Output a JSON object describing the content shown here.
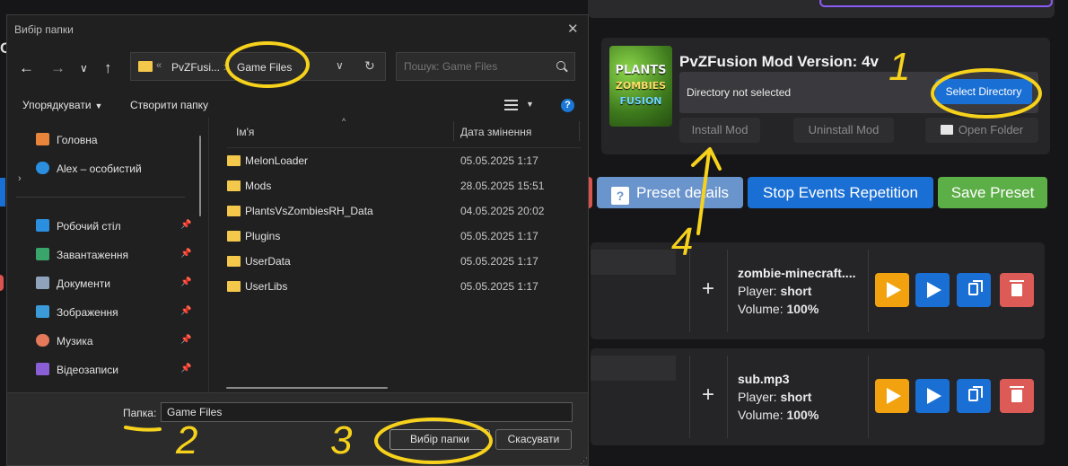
{
  "dialog": {
    "title": "Вибір папки",
    "address": {
      "seg1": "PvZFusi...",
      "separator": ">",
      "seg2": "Game Files"
    },
    "search_placeholder": "Пошук: Game Files",
    "toolbar": {
      "organize": "Упорядкувати",
      "new_folder": "Створити папку"
    },
    "nav": [
      {
        "label": "Головна",
        "icon": "home-icon",
        "pinned": false
      },
      {
        "label": "Alex – особистий",
        "icon": "cloud-icon",
        "pinned": false
      },
      {
        "label": "Робочий стіл",
        "icon": "desktop-icon",
        "pinned": true
      },
      {
        "label": "Завантаження",
        "icon": "download-icon",
        "pinned": true
      },
      {
        "label": "Документи",
        "icon": "document-icon",
        "pinned": true
      },
      {
        "label": "Зображення",
        "icon": "image-icon",
        "pinned": true
      },
      {
        "label": "Музика",
        "icon": "music-icon",
        "pinned": true
      },
      {
        "label": "Відеозаписи",
        "icon": "video-icon",
        "pinned": true
      }
    ],
    "columns": {
      "name": "Ім'я",
      "date": "Дата змінення"
    },
    "files": [
      {
        "name": "MelonLoader",
        "date": "05.05.2025 1:17"
      },
      {
        "name": "Mods",
        "date": "28.05.2025 15:51"
      },
      {
        "name": "PlantsVsZombiesRH_Data",
        "date": "04.05.2025 20:02"
      },
      {
        "name": "Plugins",
        "date": "05.05.2025 1:17"
      },
      {
        "name": "UserData",
        "date": "05.05.2025 1:17"
      },
      {
        "name": "UserLibs",
        "date": "05.05.2025 1:17"
      }
    ],
    "folder_label": "Папка:",
    "folder_value": "Game Files",
    "select_button": "Вибір папки",
    "cancel_button": "Скасувати"
  },
  "app": {
    "mod_title": "PvZFusion Mod Version: 4v",
    "logo_text": {
      "line1": "PLANTS",
      "line2": "ZOMBIES",
      "line3": "FUSION"
    },
    "directory_status": "Directory not selected",
    "select_directory": "Select Directory",
    "install_mod": "Install Mod",
    "uninstall_mod": "Uninstall Mod",
    "open_folder": "Open Folder",
    "preset_details": "Preset details",
    "stop_events": "Stop Events Repetition",
    "save_preset": "Save Preset",
    "left_letter": "C",
    "sounds": [
      {
        "name": "zombie-minecraft....",
        "player_label": "Player:",
        "player": "short",
        "volume_label": "Volume:",
        "volume": "100%"
      },
      {
        "name": "sub.mp3",
        "player_label": "Player:",
        "player": "short",
        "volume_label": "Volume:",
        "volume": "100%"
      }
    ],
    "colors": {
      "accent_blue": "#1a6fd4",
      "green": "#5cae46",
      "orange": "#f3a20f",
      "red": "#dc5b56",
      "annotation": "#f7d21c"
    }
  },
  "annotations": {
    "n1": "1",
    "n2": "2",
    "n3": "3",
    "n4": "4"
  }
}
